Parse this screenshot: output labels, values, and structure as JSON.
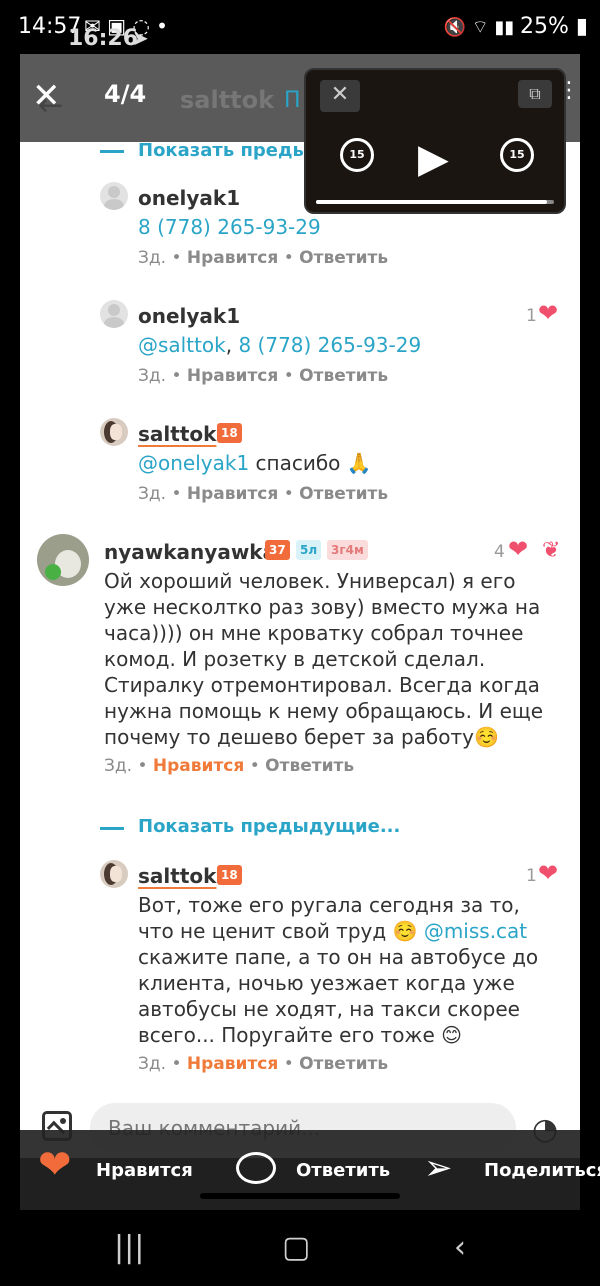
{
  "status": {
    "time": "14:57",
    "time_overlay": "16:26",
    "battery": "25%"
  },
  "header": {
    "counter": "4/4",
    "author": "salttok",
    "author_suffix": "П"
  },
  "pip": {
    "rewind": "15",
    "forward": "15",
    "progress": 0.97
  },
  "thread": {
    "show_prev_top": "Показать предыдущие...",
    "show_prev_bottom": "Показать предыдущие...",
    "comments": [
      {
        "user": "onelyak1",
        "text_link": "8 (778) 265-93-29",
        "time": "Зд.",
        "like": "Нравится",
        "reply": "Ответить"
      },
      {
        "user": "onelyak1",
        "mention": "@salttok",
        "sep": ",",
        "text_link": "8 (778) 265-93-29",
        "likes": "1",
        "time": "Зд.",
        "like": "Нравится",
        "reply": "Ответить"
      },
      {
        "user": "salttok",
        "badge": "18",
        "mention": "@onelyak1",
        "text": " спасибо 🙏",
        "time": "Зд.",
        "like": "Нравится",
        "reply": "Ответить"
      },
      {
        "user": "nyawkanyawka",
        "badge1": "37",
        "badge2": "5л",
        "badge3": "3г4м",
        "likes": "4",
        "text": "Ой хороший человек. Универсал) я его уже несколтко раз зову) вместо мужа на часа)))) он мне кроватку собрал точнее комод. И розетку в детской сделал. Стиралку отремонтировал. Всегда когда нужна помощь к нему обращаюсь. И еще почему то дешево берет за работу☺️",
        "time": "Зд.",
        "like": "Нравится",
        "reply": "Ответить"
      },
      {
        "user": "salttok",
        "badge": "18",
        "likes": "1",
        "text_a": "Вот, тоже его ругала сегодня за то, что не ценит свой труд ☺️ ",
        "mention": "@miss.cat",
        "text_b": " скажите папе, а то он на автобусе до клиента, ночью уезжает когда уже автобусы не ходят, на такси скорее всего... Поругайте его тоже 😊",
        "time": "Зд.",
        "like": "Нравится",
        "reply": "Ответить"
      }
    ]
  },
  "composer": {
    "placeholder": "Ваш комментарий..."
  },
  "actions": {
    "like": "Нравится",
    "reply": "Ответить",
    "share": "Поделиться"
  },
  "colors": {
    "accent": "#2aa5c7",
    "orange": "#f07a3a",
    "heart": "#f0506e"
  }
}
